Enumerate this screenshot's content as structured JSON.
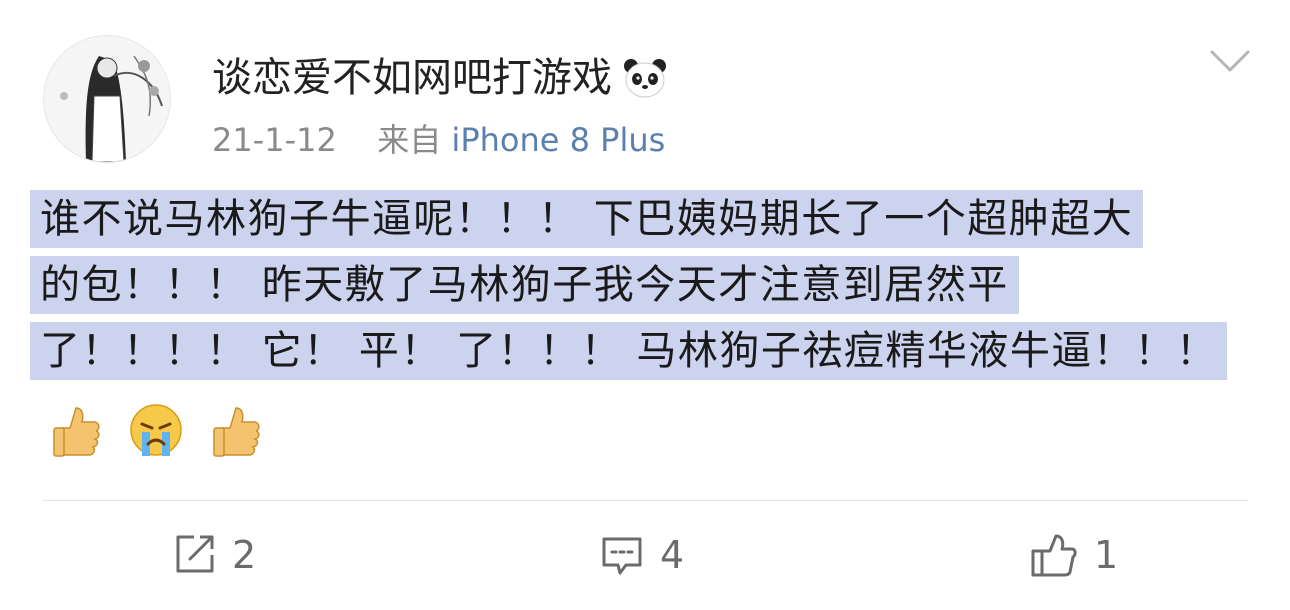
{
  "post": {
    "username": "谈恋爱不如网吧打游戏",
    "date": "21-1-12",
    "source_prefix": "来自",
    "device": "iPhone 8 Plus",
    "content_lines": [
      "谁不说马林狗子牛逼呢！！！ 下巴姨妈期长了一个超肿超大",
      "的包！！！ 昨天敷了马林狗子我今天才注意到居然平",
      "了！！！！ 它！ 平！ 了！！！ 马林狗子祛痘精华液牛逼！！！"
    ],
    "emojis": [
      "thumbs-up",
      "crying-face",
      "thumbs-up"
    ]
  },
  "actions": {
    "repost_count": "2",
    "comment_count": "4",
    "like_count": "1"
  },
  "colors": {
    "highlight": "#cbd3ee",
    "device_link": "#5b7fae",
    "meta_gray": "#8a8a8a"
  }
}
